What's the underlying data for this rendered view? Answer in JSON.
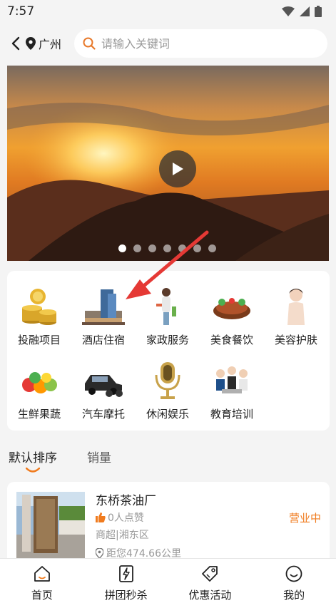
{
  "status_bar": {
    "time": "7:57"
  },
  "header": {
    "city": "广州",
    "search_placeholder": "请输入关键词"
  },
  "banner": {
    "slide_count": 7,
    "active_slide": 1
  },
  "categories": [
    {
      "label": "投融项目",
      "icon": "gold-coins-icon"
    },
    {
      "label": "酒店住宿",
      "icon": "hotel-building-icon"
    },
    {
      "label": "家政服务",
      "icon": "housekeeper-icon"
    },
    {
      "label": "美食餐饮",
      "icon": "food-dish-icon"
    },
    {
      "label": "美容护肤",
      "icon": "beauty-woman-icon"
    },
    {
      "label": "生鲜果蔬",
      "icon": "fruit-vegetable-icon"
    },
    {
      "label": "汽车摩托",
      "icon": "car-motorcycle-icon"
    },
    {
      "label": "休闲娱乐",
      "icon": "microphone-icon"
    },
    {
      "label": "教育培训",
      "icon": "students-icon"
    }
  ],
  "sort_tabs": {
    "default": "默认排序",
    "sales": "销量"
  },
  "store": {
    "name": "东桥茶油厂",
    "likes": "0人点赞",
    "category": "商超|湘东区",
    "distance": "距您474.66公里",
    "status": "营业中"
  },
  "bottom_nav": [
    {
      "label": "首页",
      "icon": "home-icon"
    },
    {
      "label": "拼团秒杀",
      "icon": "flash-sale-icon"
    },
    {
      "label": "优惠活动",
      "icon": "coupon-tag-icon"
    },
    {
      "label": "我的",
      "icon": "profile-smile-icon"
    }
  ],
  "colors": {
    "accent": "#f07b1e",
    "like": "#f07b1e"
  }
}
